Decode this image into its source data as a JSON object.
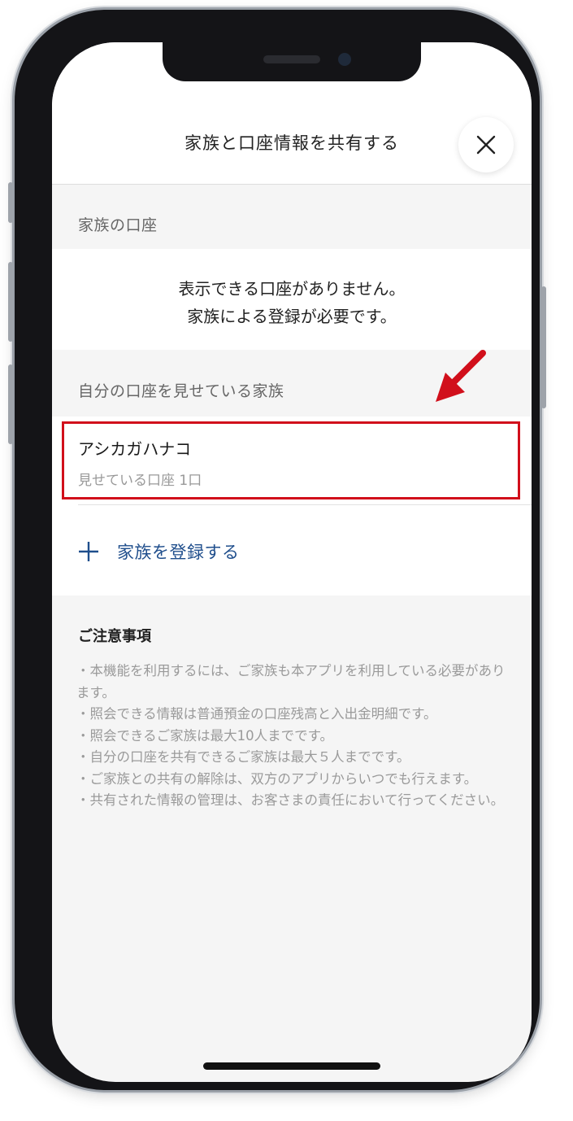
{
  "header": {
    "title": "家族と口座情報を共有する",
    "close_icon": "close-icon"
  },
  "family_accounts": {
    "label": "家族の口座",
    "empty_line1": "表示できる口座がありません。",
    "empty_line2": "家族による登録が必要です。"
  },
  "sharing_family": {
    "label": "自分の口座を見せている家族",
    "members": [
      {
        "name": "アシカガハナコ",
        "detail": "見せている口座 1口"
      }
    ]
  },
  "add_family": {
    "icon": "plus-icon",
    "label": "家族を登録する"
  },
  "notes": {
    "title": "ご注意事項",
    "items": [
      "・本機能を利用するには、ご家族も本アプリを利用している必要があります。",
      "・照会できる情報は普通預金の口座残高と入出金明細です。",
      "・照会できるご家族は最大10人までです。",
      "・自分の口座を共有できるご家族は最大５人までです。",
      "・ご家族との共有の解除は、双方のアプリからいつでも行えます。",
      "・共有された情報の管理は、お客さまの責任において行ってください。"
    ]
  },
  "colors": {
    "accent_blue": "#1f4e8c",
    "highlight_red": "#d10f1b",
    "background": "#f5f5f5"
  }
}
